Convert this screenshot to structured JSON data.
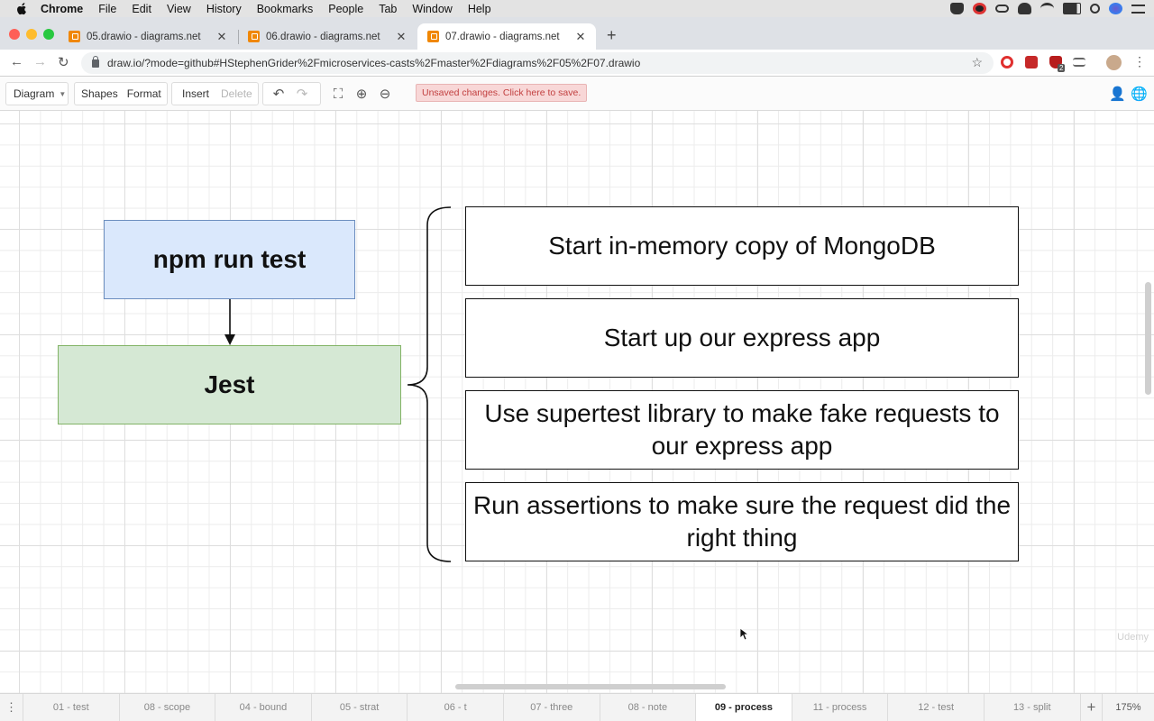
{
  "menubar": {
    "app": "Chrome",
    "items": [
      "File",
      "Edit",
      "View",
      "History",
      "Bookmarks",
      "People",
      "Tab",
      "Window",
      "Help"
    ]
  },
  "browser": {
    "tabs": [
      {
        "title": "05.drawio - diagrams.net",
        "active": false
      },
      {
        "title": "06.drawio - diagrams.net",
        "active": false
      },
      {
        "title": "07.drawio - diagrams.net",
        "active": true
      }
    ],
    "url": "draw.io/?mode=github#HStephenGrider%2Fmicroservices-casts%2Fmaster%2Fdiagrams%2F05%2F07.drawio",
    "extension_badge": "2"
  },
  "drawio_toolbar": {
    "diagram_menu": "Diagram",
    "shapes": "Shapes",
    "format": "Format",
    "insert": "Insert",
    "delete": "Delete",
    "unsaved_notice": "Unsaved changes. Click here to save."
  },
  "diagram": {
    "command_box": "npm run test",
    "runner_box": "Jest",
    "steps": [
      "Start in-memory copy of MongoDB",
      "Start up our express app",
      "Use supertest library to make fake requests to our express app",
      "Run assertions to make sure the request did the right thing"
    ],
    "colors": {
      "command_fill": "#dae8fc",
      "command_border": "#6c8ebf",
      "runner_fill": "#d5e8d4",
      "runner_border": "#82b366"
    }
  },
  "page_tabs": {
    "tabs": [
      "01 - test",
      "08 - scope",
      "04 - bound",
      "05 - strat",
      "06 - t",
      "07 - three",
      "08 - note",
      "09 - process",
      "11 - process",
      "12 - test",
      "13 - split"
    ],
    "active_index": 7,
    "zoom": "175%"
  },
  "watermark": "Udemy"
}
